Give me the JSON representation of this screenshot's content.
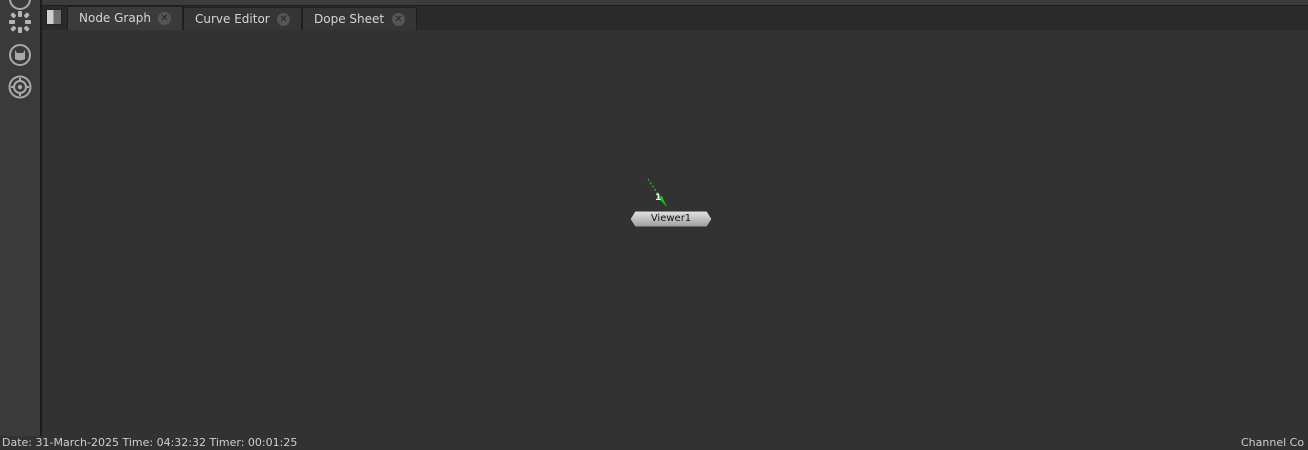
{
  "toolbar": {
    "icons": [
      "circle-tool-icon",
      "particles-icon",
      "cat-face-icon",
      "gear-ring-icon"
    ]
  },
  "tabs": [
    {
      "label": "Node Graph",
      "active": true
    },
    {
      "label": "Curve Editor",
      "active": false
    },
    {
      "label": "Dope Sheet",
      "active": false
    }
  ],
  "node_graph": {
    "node": {
      "label": "Viewer1",
      "input_number": "1"
    },
    "wire_color": "#22c922",
    "node_color": "#c8c8c8"
  },
  "status": {
    "left": "Date: 31-March-2025 Time: 04:32:32 Timer: 00:01:25",
    "right": "Channel Co"
  }
}
